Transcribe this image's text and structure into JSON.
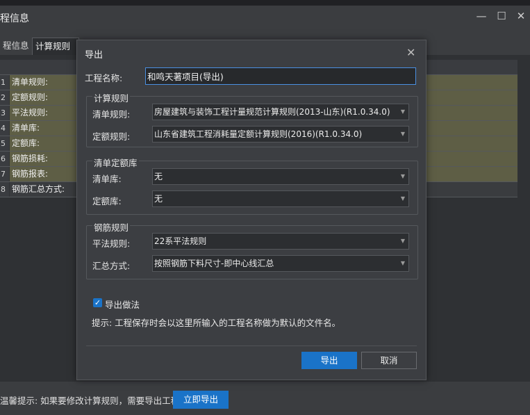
{
  "window": {
    "title": "程信息",
    "minimize_glyph": "—",
    "maximize_glyph": "☐",
    "close_glyph": "✕"
  },
  "tabs": [
    {
      "label": "程信息"
    },
    {
      "label": "计算规则"
    }
  ],
  "grid": {
    "rows": [
      {
        "num": "1",
        "label": "清单规则:"
      },
      {
        "num": "2",
        "label": "定额规则:"
      },
      {
        "num": "3",
        "label": "平法规则:"
      },
      {
        "num": "4",
        "label": "清单库:"
      },
      {
        "num": "5",
        "label": "定额库:"
      },
      {
        "num": "6",
        "label": "钢筋损耗:"
      },
      {
        "num": "7",
        "label": "钢筋报表:"
      },
      {
        "num": "8",
        "label": "钢筋汇总方式:"
      }
    ]
  },
  "bottom": {
    "hint": "温馨提示: 如果要修改计算规则，需要导出工程",
    "export_now": "立即导出"
  },
  "dialog": {
    "title": "导出",
    "close_glyph": "✕",
    "project_name_label": "工程名称:",
    "project_name_value": "和鸣天著项目(导出)",
    "calc_group": {
      "title": "计算规则",
      "list_rule_label": "清单规则:",
      "list_rule_value": "房屋建筑与装饰工程计量规范计算规则(2013-山东)(R1.0.34.0)",
      "quota_rule_label": "定额规则:",
      "quota_rule_value": "山东省建筑工程消耗量定额计算规则(2016)(R1.0.34.0)"
    },
    "library_group": {
      "title": "清单定额库",
      "list_lib_label": "清单库:",
      "list_lib_value": "无",
      "quota_lib_label": "定额库:",
      "quota_lib_value": "无"
    },
    "rebar_group": {
      "title": "钢筋规则",
      "flat_rule_label": "平法规则:",
      "flat_rule_value": "22系平法规则",
      "summary_label": "汇总方式:",
      "summary_value": "按照钢筋下料尺寸-即中心线汇总"
    },
    "export_method_label": "导出做法",
    "export_method_checked": true,
    "tip": "提示: 工程保存时会以这里所输入的工程名称做为默认的文件名。",
    "export_button": "导出",
    "cancel_button": "取消"
  },
  "colors": {
    "accent": "#1a73c8",
    "row_highlight": "#5e5e45",
    "background": "#3b3d40"
  }
}
